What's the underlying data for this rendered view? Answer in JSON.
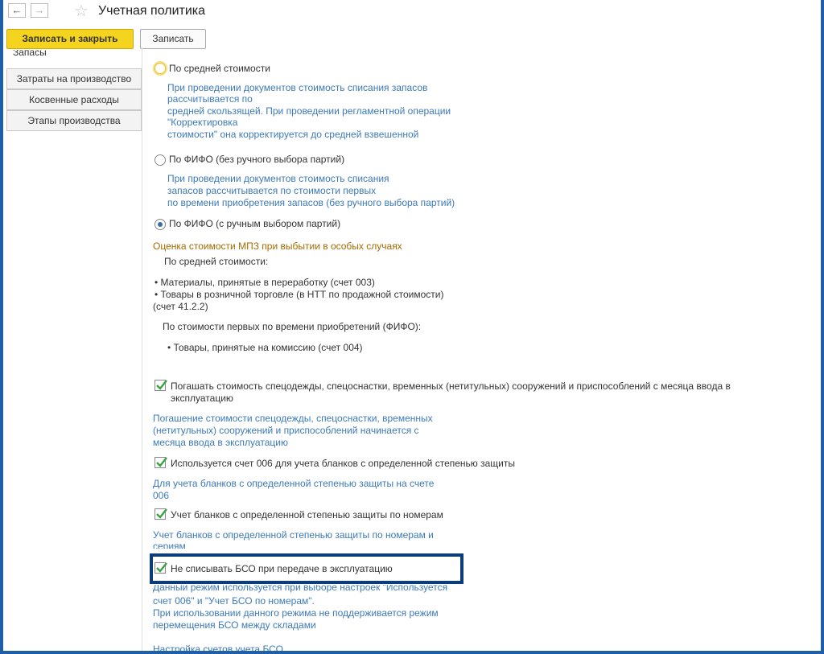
{
  "window": {
    "title": "Учетная политика",
    "back_icon": "arrow-left-icon",
    "forward_icon": "arrow-right-icon",
    "favorite_icon": "star-outline-icon"
  },
  "toolbar": {
    "save_close_label": "Записать и закрыть",
    "save_label": "Записать"
  },
  "sidebar": {
    "cut_item": "Запасы",
    "items": [
      {
        "label": "Затраты на производство"
      },
      {
        "label": "Косвенные расходы"
      },
      {
        "label": "Этапы производства"
      }
    ]
  },
  "content": {
    "radio_avg": {
      "label": "По средней стоимости",
      "hint1": "При проведении документов стоимость списания запасов",
      "hint2": "рассчитывается по",
      "hint3": "средней скользящей. При проведении регламентной операции",
      "hint4": "\"Корректировка",
      "hint5": "стоимости\" она корректируется до средней взвешенной"
    },
    "radio_fifo_auto": {
      "label": "По ФИФО (без ручного выбора партий)",
      "hint1": "При проведении документов стоимость списания",
      "hint2": "запасов рассчитывается по стоимости первых",
      "hint3": "по времени приобретения запасов (без ручного выбора партий)"
    },
    "radio_fifo_manual": {
      "label": "По ФИФО (с ручным выбором партий)",
      "selected": true
    },
    "special_cases": {
      "title": "Оценка стоимости МПЗ при выбытии в  особых случаях",
      "avg_heading": "По средней стоимости:",
      "avg_item1": "• Материалы, принятые в переработку (счет 003)",
      "avg_item2": "• Товары в розничной торговле (в НТТ по продажной стоимости)",
      "avg_item2b": "(счет 41.2.2)",
      "fifo_heading": "По стоимости первых по времени приобретений (ФИФО):",
      "fifo_item1": "• Товары, принятые на комиссию (счет 004)"
    },
    "check_workwear": {
      "checked": true,
      "label1": "Погашать стоимость спецодежды, спецоснастки,  временных (нетитульных) сооружений и приспособлений с месяца ввода в",
      "label2": "эксплуатацию",
      "hint1": "Погашение стоимости спецодежды, спецоснастки, временных",
      "hint2": "(нетитульных) сооружений и приспособлений начинается с",
      "hint3": "месяца ввода в эксплуатацию"
    },
    "check_account006": {
      "checked": true,
      "label": "Используется счет 006 для учета бланков с определенной степенью защиты",
      "hint1": "Для учета бланков с определенной степенью защиты на счете",
      "hint2": "006"
    },
    "check_numbers": {
      "checked": true,
      "label": "Учет бланков с определенной степенью защиты по номерам",
      "hint1": "Учет бланков с определенной степенью защиты по номерам и",
      "hint2": "сериям"
    },
    "check_bso": {
      "checked": true,
      "label": "Не списывать БСО при передаче в эксплуатацию",
      "hint1": "Данный режим используется при выборе настроек \"Используется",
      "hint2": "счет 006\" и \"Учет БСО по номерам\".",
      "hint3": "При использовании данного режима не поддерживается режим",
      "hint4": "перемещения БСО между складами"
    },
    "bso_accounts_link": "Настройка счетов учета БСО"
  },
  "colors": {
    "frame": "#1f5fa8",
    "primary_button": "#f5d41f",
    "hint_text": "#3d7ab8",
    "section_title": "#a36a00",
    "checkmark": "#3aa144",
    "highlight_box": "#0b3d7a"
  }
}
